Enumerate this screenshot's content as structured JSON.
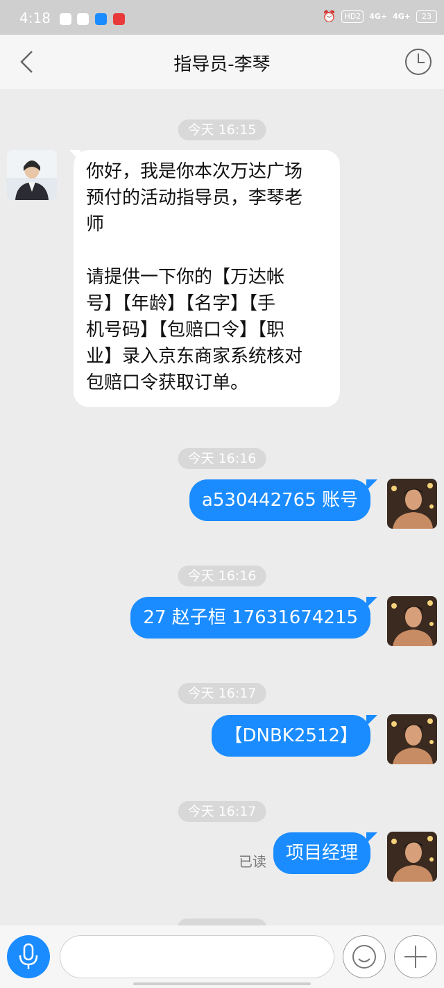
{
  "status_bar": {
    "time": "4:18",
    "network_1": "4G+",
    "network_2": "4G+",
    "hd": "HD2",
    "battery": "23"
  },
  "header": {
    "title": "指导员-李琴"
  },
  "messages": [
    {
      "timestamp": "今天 16:15",
      "direction": "in",
      "text": "你好，我是你本次万达广场\n预付的活动指导员，李琴老\n师\n\n请提供一下你的【万达帐\n号】【年龄】【名字】【手\n机号码】【包赔口令】【职\n业】录入京东商家系统核对\n包赔口令获取订单。"
    },
    {
      "timestamp": "今天 16:16",
      "direction": "out",
      "text": "a530442765 账号"
    },
    {
      "timestamp": "今天 16:16",
      "direction": "out",
      "text": "27 赵子桓 17631674215"
    },
    {
      "timestamp": "今天 16:17",
      "direction": "out",
      "text": "【DNBK2512】"
    },
    {
      "timestamp": "今天 16:17",
      "direction": "out",
      "text": "项目经理",
      "status": "已读"
    }
  ],
  "input": {
    "value": "",
    "placeholder": ""
  },
  "icons": {
    "back": "chevron-left-icon",
    "history": "clock-icon",
    "mic": "microphone-icon",
    "emoji": "smiley-icon",
    "plus": "plus-icon"
  },
  "colors": {
    "accent": "#1a8cff",
    "background": "#ececec",
    "timestamp_bg": "#d8d8d8"
  }
}
